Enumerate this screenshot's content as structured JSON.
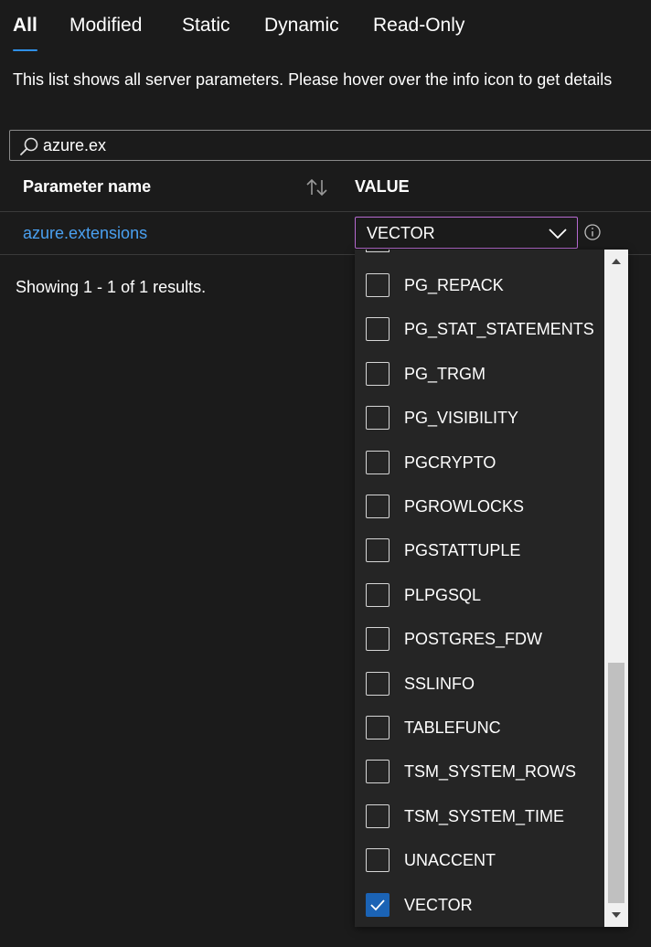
{
  "tabs": [
    {
      "label": "All",
      "active": true
    },
    {
      "label": "Modified",
      "active": false
    },
    {
      "label": "Static",
      "active": false
    },
    {
      "label": "Dynamic",
      "active": false
    },
    {
      "label": "Read-Only",
      "active": false
    }
  ],
  "description": "This list shows all server parameters. Please hover over the info icon to get details",
  "search": {
    "value": "azure.ex",
    "icon": "search-icon"
  },
  "table": {
    "col_name": "Parameter name",
    "col_value": "VALUE",
    "rows": [
      {
        "name": "azure.extensions",
        "value": "VECTOR"
      }
    ]
  },
  "results_text": "Showing 1 - 1 of 1 results.",
  "dropdown": {
    "options": [
      {
        "label": "PG_REPACK",
        "checked": false
      },
      {
        "label": "PG_STAT_STATEMENTS",
        "checked": false
      },
      {
        "label": "PG_TRGM",
        "checked": false
      },
      {
        "label": "PG_VISIBILITY",
        "checked": false
      },
      {
        "label": "PGCRYPTO",
        "checked": false
      },
      {
        "label": "PGROWLOCKS",
        "checked": false
      },
      {
        "label": "PGSTATTUPLE",
        "checked": false
      },
      {
        "label": "PLPGSQL",
        "checked": false
      },
      {
        "label": "POSTGRES_FDW",
        "checked": false
      },
      {
        "label": "SSLINFO",
        "checked": false
      },
      {
        "label": "TABLEFUNC",
        "checked": false
      },
      {
        "label": "TSM_SYSTEM_ROWS",
        "checked": false
      },
      {
        "label": "TSM_SYSTEM_TIME",
        "checked": false
      },
      {
        "label": "UNACCENT",
        "checked": false
      },
      {
        "label": "VECTOR",
        "checked": true
      }
    ]
  },
  "colors": {
    "accent": "#2f8fe6",
    "link": "#4aa0f0",
    "select_border": "#b66ad0",
    "checkbox_checked": "#1b63b5"
  }
}
